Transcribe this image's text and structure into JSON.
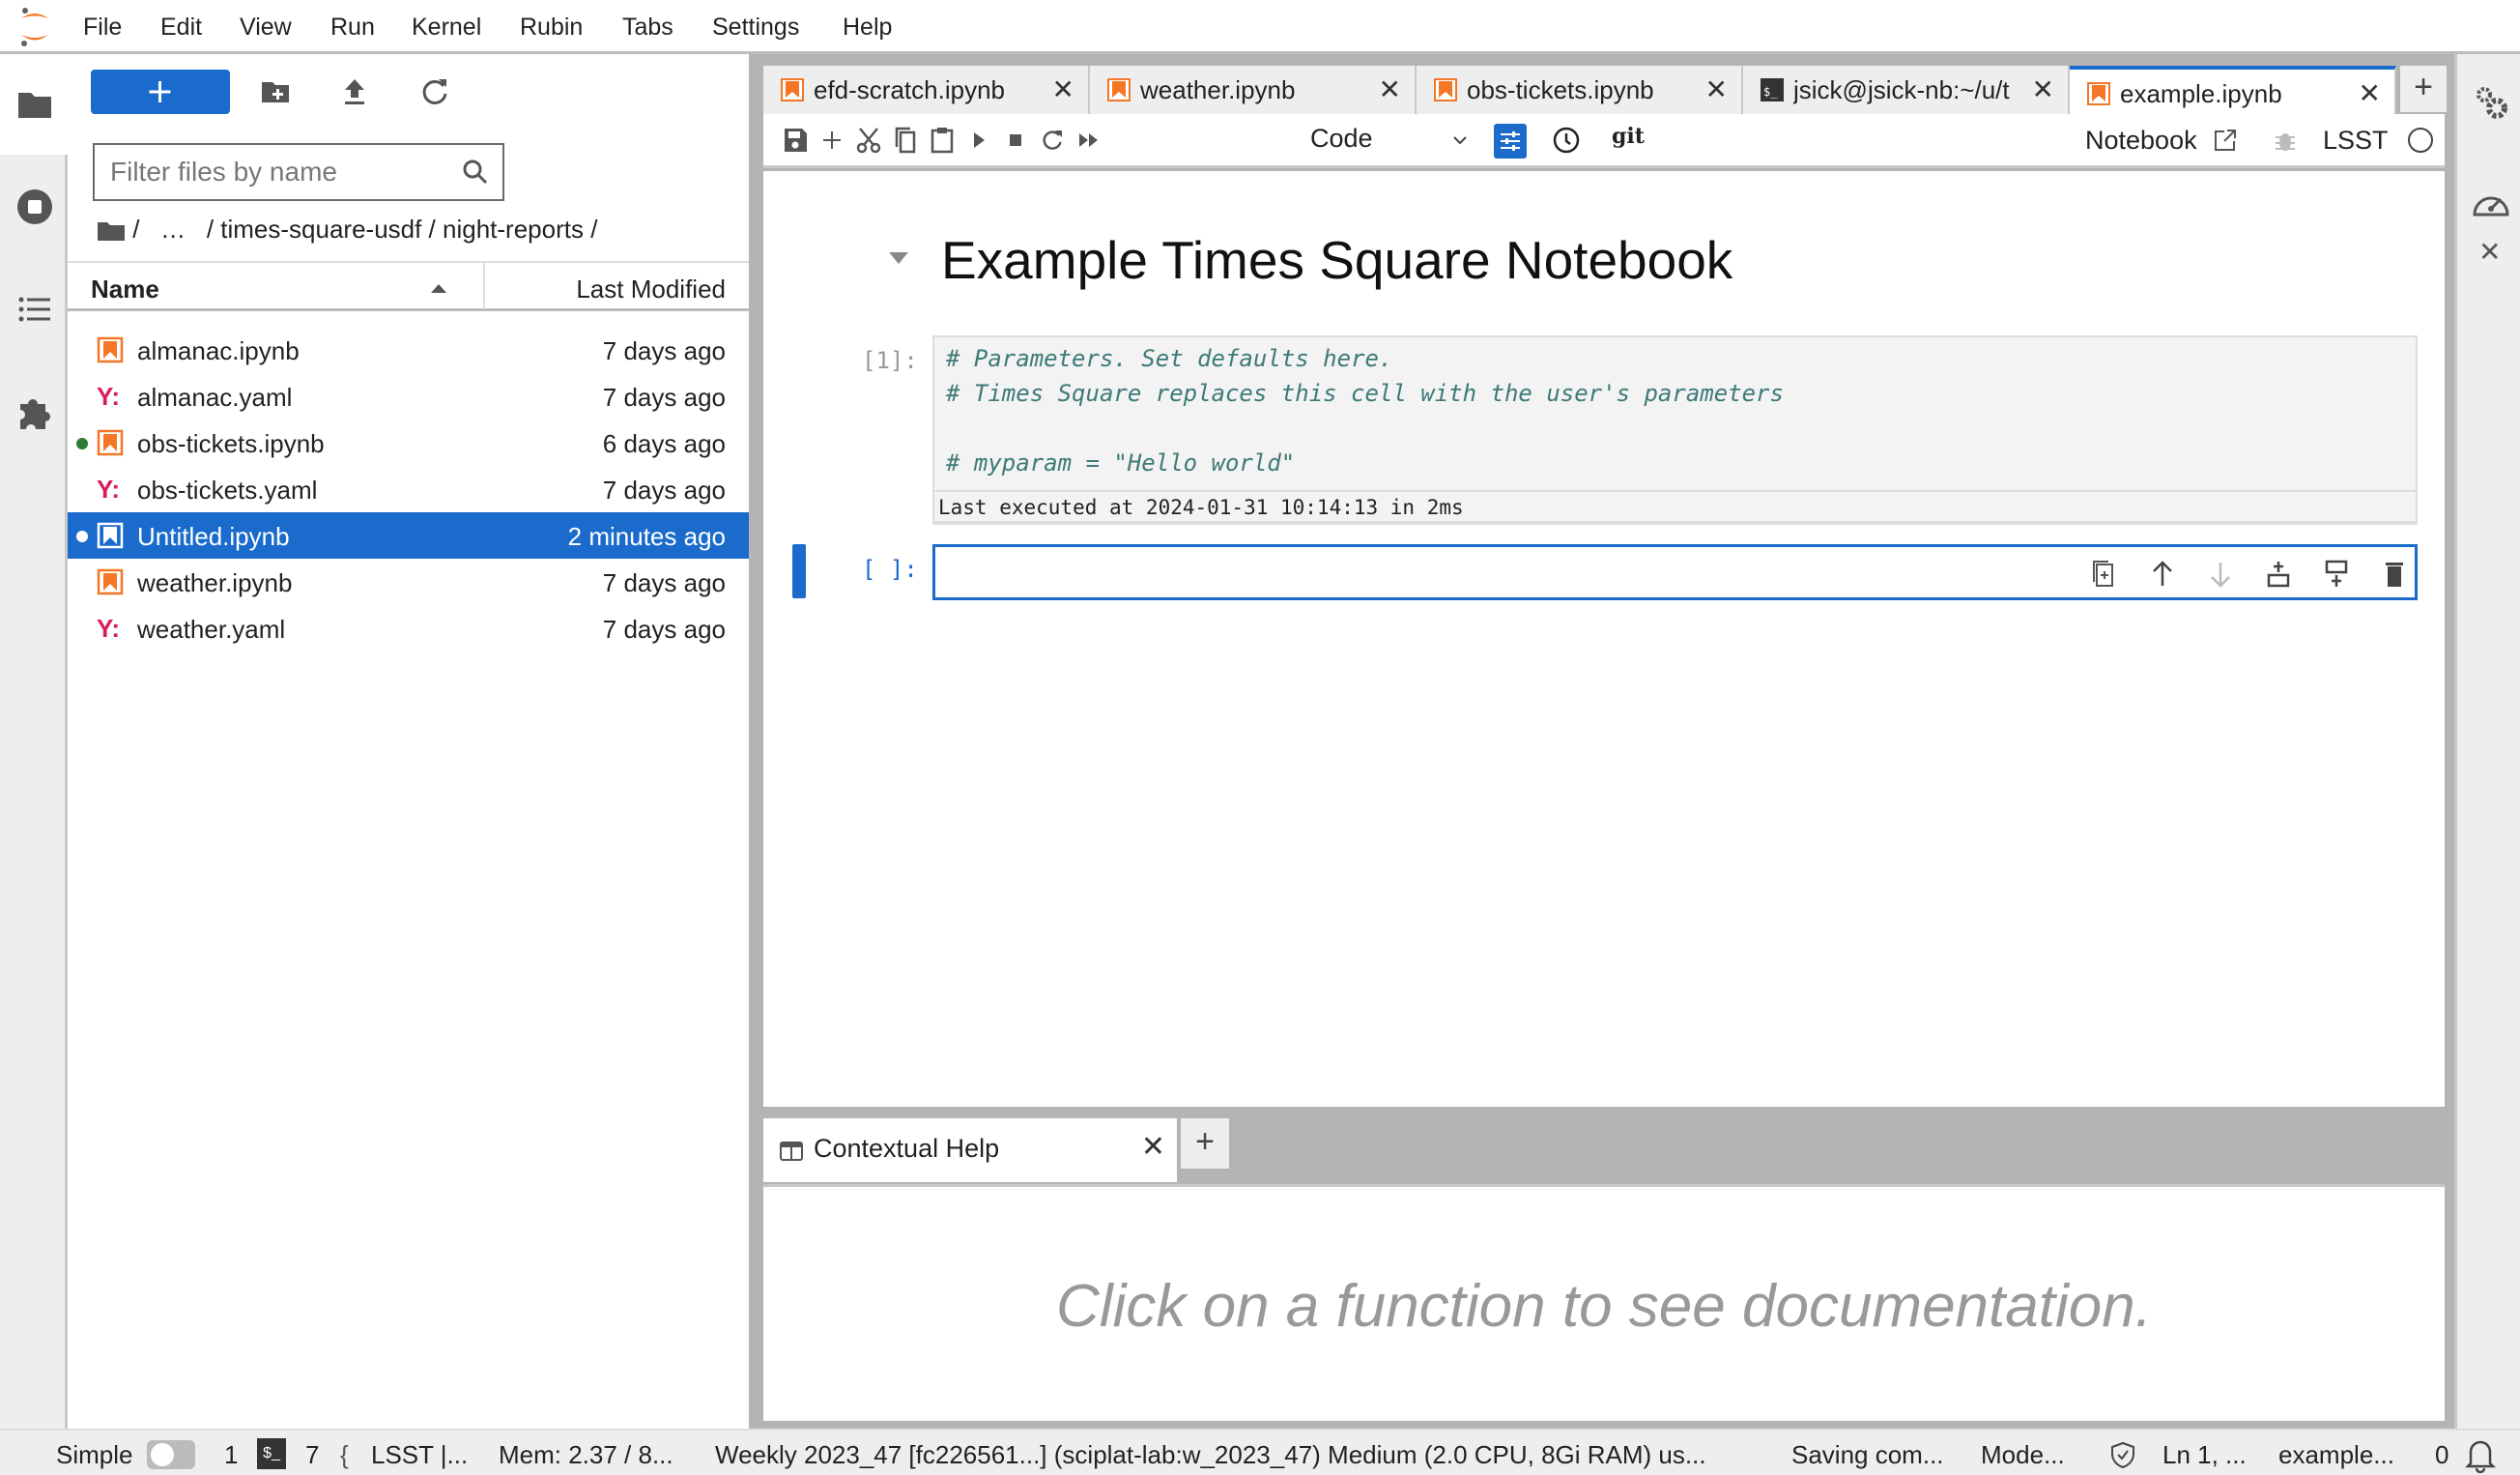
{
  "menubar": {
    "items": [
      "File",
      "Edit",
      "View",
      "Run",
      "Kernel",
      "Rubin",
      "Tabs",
      "Settings",
      "Help"
    ]
  },
  "filebrowser": {
    "new_button_label": "+",
    "filter_placeholder": "Filter files by name",
    "filter_value": "",
    "breadcrumb": {
      "root": "/",
      "ellipsis": "…",
      "path": "/ times-square-usdf / night-reports /"
    },
    "columns": {
      "name": "Name",
      "modified": "Last Modified"
    },
    "files": [
      {
        "name": "almanac.ipynb",
        "modified": "7 days ago",
        "type": "notebook",
        "running": false,
        "selected": false
      },
      {
        "name": "almanac.yaml",
        "modified": "7 days ago",
        "type": "yaml",
        "running": false,
        "selected": false
      },
      {
        "name": "obs-tickets.ipynb",
        "modified": "6 days ago",
        "type": "notebook",
        "running": true,
        "selected": false
      },
      {
        "name": "obs-tickets.yaml",
        "modified": "7 days ago",
        "type": "yaml",
        "running": false,
        "selected": false
      },
      {
        "name": "Untitled.ipynb",
        "modified": "2 minutes ago",
        "type": "notebook",
        "running": true,
        "selected": true
      },
      {
        "name": "weather.ipynb",
        "modified": "7 days ago",
        "type": "notebook",
        "running": false,
        "selected": false
      },
      {
        "name": "weather.yaml",
        "modified": "7 days ago",
        "type": "yaml",
        "running": false,
        "selected": false
      }
    ]
  },
  "tabs": [
    {
      "label": "efd-scratch.ipynb",
      "icon": "notebook-icon",
      "active": false
    },
    {
      "label": "weather.ipynb",
      "icon": "notebook-icon",
      "active": false
    },
    {
      "label": "obs-tickets.ipynb",
      "icon": "notebook-icon",
      "active": false
    },
    {
      "label": "jsick@jsick-nb:~/u/t",
      "icon": "terminal-icon",
      "active": false
    },
    {
      "label": "example.ipynb",
      "icon": "notebook-icon",
      "active": true
    }
  ],
  "toolbar": {
    "cell_type": "Code",
    "git_label": "git",
    "notebook_label": "Notebook",
    "kernel_name": "LSST"
  },
  "notebook": {
    "heading": "Example Times Square Notebook",
    "cells": [
      {
        "prompt": "[1]:",
        "lines": [
          "# Parameters. Set defaults here.",
          "# Times Square replaces this cell with the user's parameters",
          "",
          "# myparam = \"Hello world\""
        ],
        "exec_info": "Last executed at 2024-01-31 10:14:13 in 2ms"
      },
      {
        "prompt": "[ ]:",
        "lines": []
      }
    ]
  },
  "bottom_panel": {
    "tab_label": "Contextual Help",
    "message": "Click on a function to see documentation."
  },
  "statusbar": {
    "mode_label": "Simple",
    "kernels_count": "1",
    "terminals_count": "7",
    "kernel": "LSST |...",
    "memory": "Mem: 2.37 / 8...",
    "image": "Weekly 2023_47 [fc226561...] (sciplat-lab:w_2023_47) Medium (2.0 CPU, 8Gi RAM) us...",
    "saving": "Saving com...",
    "mode": "Mode...",
    "cursor": "Ln 1, ...",
    "file": "example...",
    "notifications": "0"
  },
  "colors": {
    "accent": "#1a6bcc",
    "notebook_icon": "#f37726",
    "yaml_icon": "#d81b60",
    "running_dot": "#2e7d32",
    "code_comment": "#3d7a77"
  }
}
